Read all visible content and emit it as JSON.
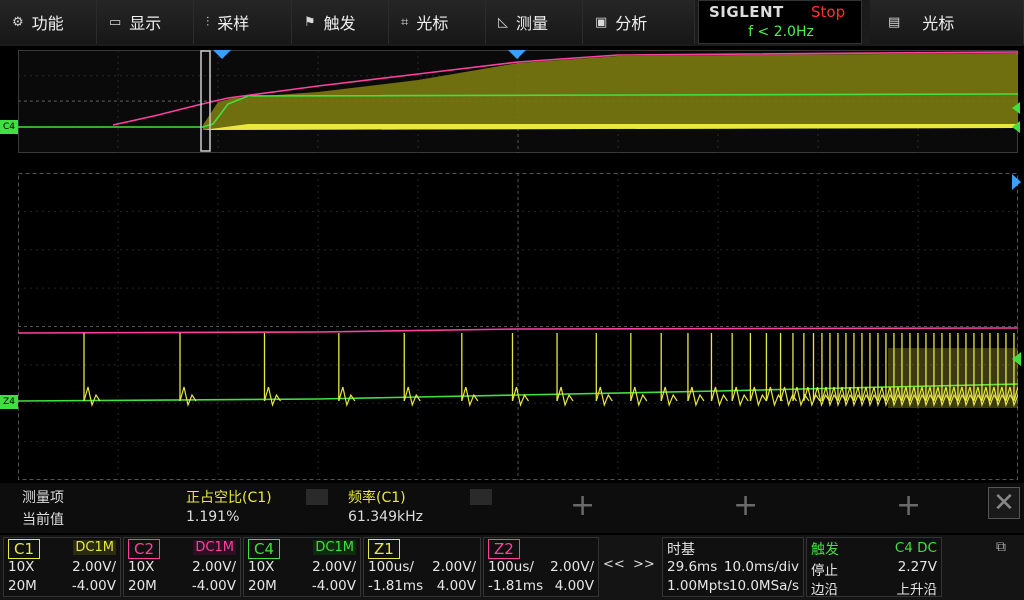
{
  "menu": {
    "items": [
      {
        "label": "功能",
        "icon": "gear-icon",
        "glyph": "⚙"
      },
      {
        "label": "显示",
        "icon": "display-icon",
        "glyph": "▭"
      },
      {
        "label": "采样",
        "icon": "acquire-icon",
        "glyph": "⫶"
      },
      {
        "label": "触发",
        "icon": "flag-icon",
        "glyph": "⚑"
      },
      {
        "label": "光标",
        "icon": "cursor-icon",
        "glyph": "⌗"
      },
      {
        "label": "测量",
        "icon": "ruler-icon",
        "glyph": "◺"
      },
      {
        "label": "分析",
        "icon": "analysis-icon",
        "glyph": "▣"
      }
    ],
    "brand": "SIGLENT",
    "run_state": "Stop",
    "trigger_freq": "f < 2.0Hz",
    "cursor_button": {
      "label": "光标",
      "icon": "menu-icon",
      "glyph": "▤"
    }
  },
  "markers": {
    "overview_ch4": "C4",
    "main_z4": "Z4"
  },
  "measure": {
    "header_label": "测量项",
    "value_label": "当前值",
    "items": [
      {
        "name": "正占空比(C1)",
        "value": "1.191%"
      },
      {
        "name": "频率(C1)",
        "value": "61.349kHz"
      }
    ],
    "close_glyph": "✕"
  },
  "channels": [
    {
      "name": "C1",
      "coupling": "DC1M",
      "probe": "10X",
      "scale": "2.00V/",
      "bw": "20M",
      "offset": "-4.00V",
      "color": "#e8e840"
    },
    {
      "name": "C2",
      "coupling": "DC1M",
      "probe": "10X",
      "scale": "2.00V/",
      "bw": "20M",
      "offset": "-4.00V",
      "color": "#ff40a0"
    },
    {
      "name": "C4",
      "coupling": "DC1M",
      "probe": "10X",
      "scale": "2.00V/",
      "bw": "20M",
      "offset": "-4.00V",
      "color": "#40e040"
    }
  ],
  "zooms": [
    {
      "name": "Z1",
      "r1a": "100us/",
      "r1b": "2.00V/",
      "r2a": "-1.81ms",
      "r2b": "4.00V",
      "color": "#e8e840"
    },
    {
      "name": "Z2",
      "r1a": "100us/",
      "r1b": "2.00V/",
      "r2a": "-1.81ms",
      "r2b": "4.00V",
      "color": "#ff40a0"
    }
  ],
  "nav": {
    "prev": "<<",
    "next": ">>"
  },
  "timebase": {
    "title": "时基",
    "delay": "29.6ms",
    "scale": "10.0ms/div",
    "mem": "1.00Mpts",
    "rate": "10.0MSa/s"
  },
  "trigger": {
    "title": "触发",
    "source": "C4 DC",
    "state": "停止",
    "level": "2.27V",
    "type": "边沿",
    "slope": "上升沿"
  },
  "status_icon": {
    "name": "network-icon",
    "glyph": "⧉"
  },
  "colors": {
    "c1": "#e8e840",
    "c2": "#ff40a0",
    "c4": "#40e040",
    "menu_bg": "#1b1b1b"
  }
}
